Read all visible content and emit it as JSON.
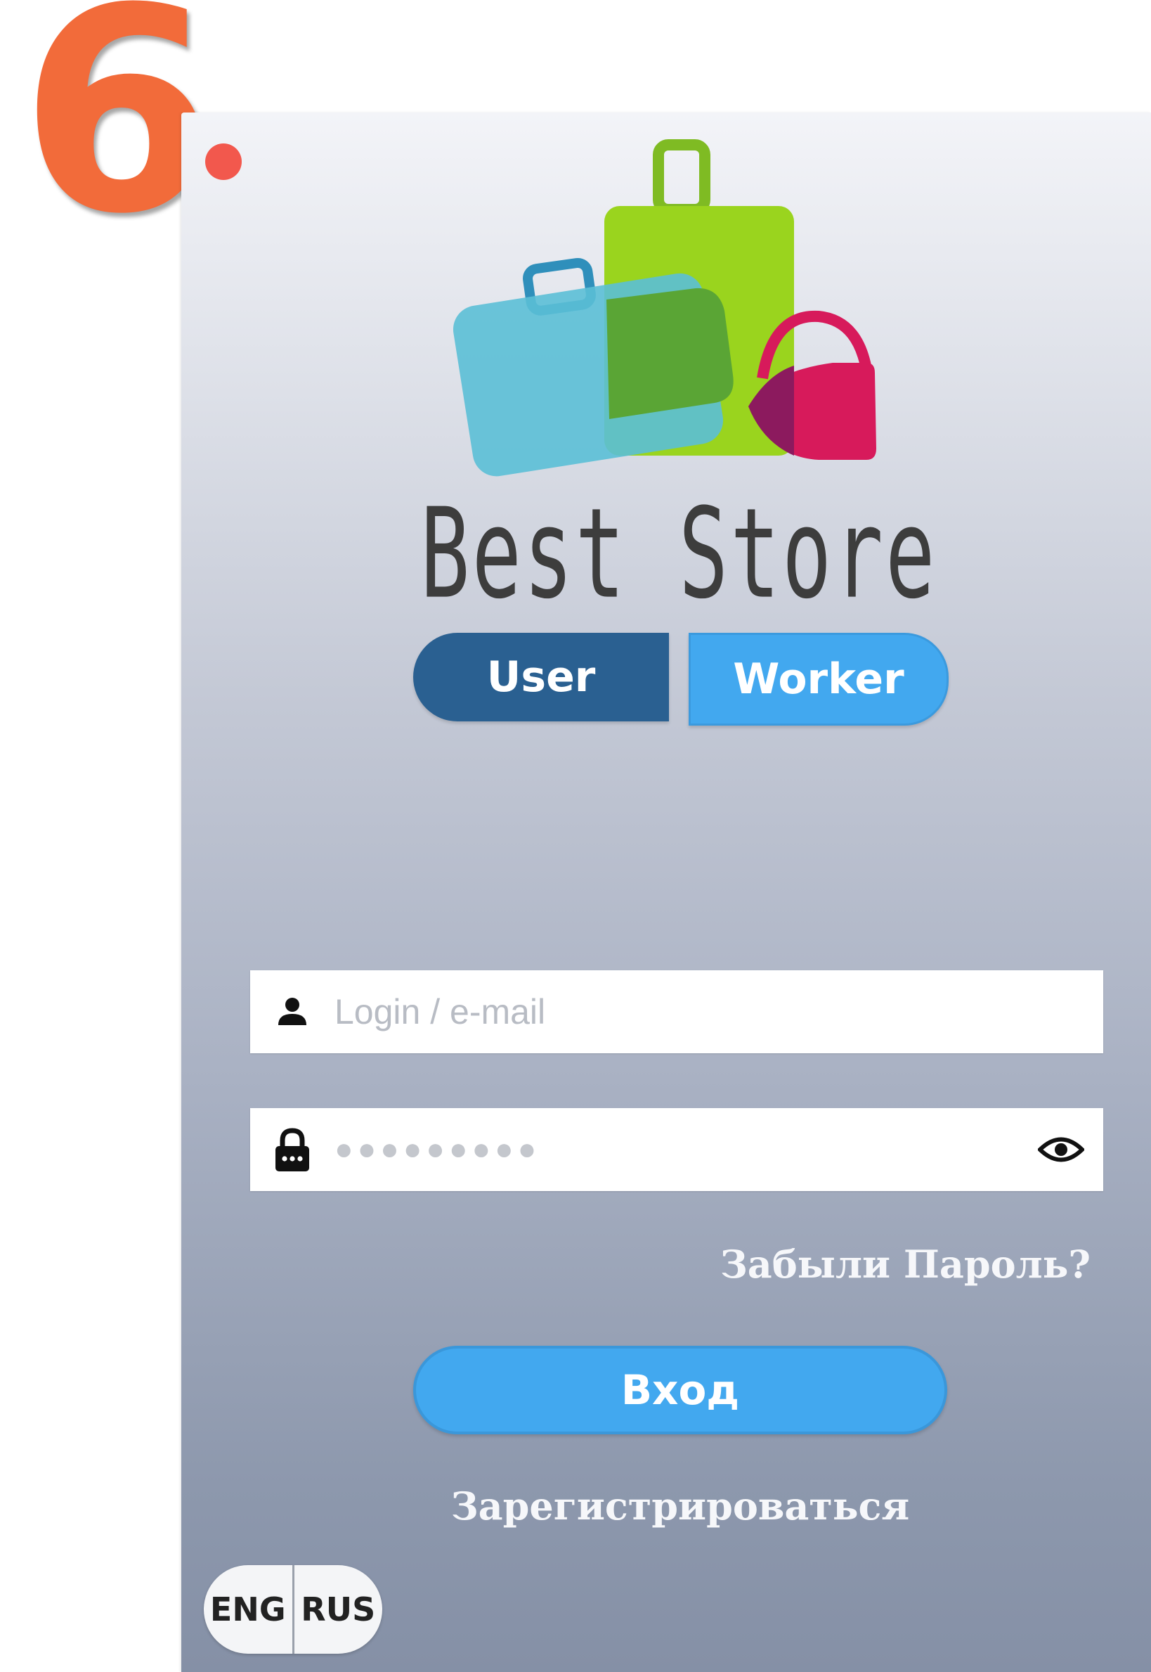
{
  "annotation": {
    "step_number": "6",
    "step_color": "#f26b3a",
    "dot_color": "#f2584d"
  },
  "app": {
    "brand_name": "Best Store",
    "logo_icon": "luggage-bags-logo"
  },
  "role_toggle": {
    "user_label": "User",
    "worker_label": "Worker",
    "active": "User",
    "active_color": "#2a6091",
    "inactive_color": "#42a8ef"
  },
  "login_form": {
    "login_field": {
      "placeholder": "Login / e-mail",
      "value": "",
      "icon": "user-icon"
    },
    "password_field": {
      "masked_value": "●●●●●●●●●",
      "icon": "lock-icon",
      "toggle_icon": "eye-icon"
    },
    "forgot_password_label": "Забыли Пароль?",
    "submit_label": "Вход",
    "register_label": "Зарегистрироваться",
    "accent_color": "#42a8ef"
  },
  "language_switch": {
    "options": [
      "ENG",
      "RUS"
    ]
  }
}
